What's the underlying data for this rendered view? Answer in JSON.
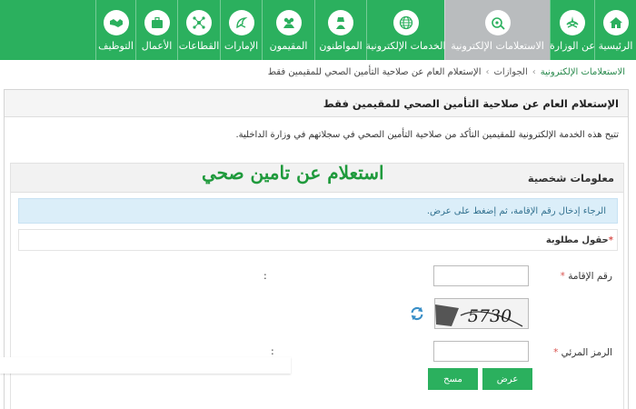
{
  "nav": {
    "items": [
      {
        "label": "الرئيسية",
        "icon": "home-icon",
        "active": false
      },
      {
        "label": "عن الوزارة",
        "icon": "emblem-icon",
        "active": false
      },
      {
        "label": "الاستعلامات الإلكترونية",
        "icon": "inquiry-icon",
        "active": true
      },
      {
        "label": "الخدمات الإلكترونية",
        "icon": "globe-icon",
        "active": false
      },
      {
        "label": "المواطنون",
        "icon": "citizen-icon",
        "active": false
      },
      {
        "label": "المقيمون",
        "icon": "residents-icon",
        "active": false
      },
      {
        "label": "الإمارات",
        "icon": "emirates-icon",
        "active": false
      },
      {
        "label": "القطاعات",
        "icon": "network-icon",
        "active": false
      },
      {
        "label": "الأعمال",
        "icon": "briefcase-icon",
        "active": false
      },
      {
        "label": "التوظيف",
        "icon": "handshake-icon",
        "active": false
      }
    ],
    "colors": {
      "bar": "#2bb05e",
      "active": "#b9bcbe"
    }
  },
  "breadcrumb": {
    "root": "الاستعلامات الإلكترونية",
    "middle": "الجوازات",
    "current": "الإستعلام العام عن صلاحية التأمين الصحي للمقيمين فقط"
  },
  "panel": {
    "title": "الإستعلام العام عن صلاحية التأمين الصحي للمقيمين فقط",
    "intro": "تتيح هذه الخدمة الإلكترونية للمقيمين التأكد من صلاحية التأمين الصحي في سجلاتهم في وزارة الداخلية."
  },
  "section": {
    "title": "معلومات شخصية",
    "overlay": "استعلام عن تامين صحي",
    "info": "الرجاء إدخال رقم الإقامة، ثم إضغط على عرض.",
    "required_note": "حقول مطلوبة"
  },
  "form": {
    "iqama_label": "رقم الإقامة",
    "captcha_label": "الرمز المرئي",
    "iqama_value": "",
    "captcha_value": "",
    "captcha_image_text": "5730"
  },
  "buttons": {
    "show": "عرض",
    "clear": "مسح"
  }
}
